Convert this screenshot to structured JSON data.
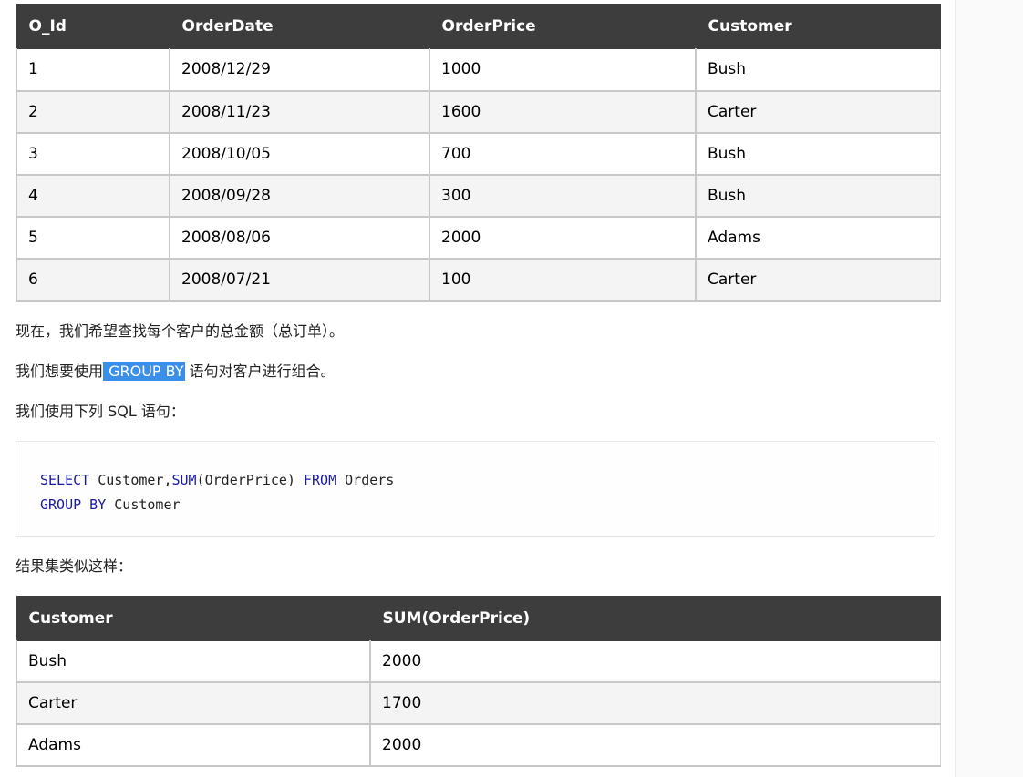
{
  "orders_table": {
    "headers": [
      "O_Id",
      "OrderDate",
      "OrderPrice",
      "Customer"
    ],
    "rows": [
      [
        "1",
        "2008/12/29",
        "1000",
        "Bush"
      ],
      [
        "2",
        "2008/11/23",
        "1600",
        "Carter"
      ],
      [
        "3",
        "2008/10/05",
        "700",
        "Bush"
      ],
      [
        "4",
        "2008/09/28",
        "300",
        "Bush"
      ],
      [
        "5",
        "2008/08/06",
        "2000",
        "Adams"
      ],
      [
        "6",
        "2008/07/21",
        "100",
        "Carter"
      ]
    ]
  },
  "para1": "现在，我们希望查找每个客户的总金额（总订单）。",
  "para2": {
    "before": "我们想要使用",
    "highlight": " GROUP BY",
    "after": " 语句对客户进行组合。"
  },
  "para3": "我们使用下列 SQL 语句：",
  "code": {
    "line1": {
      "kw1": "SELECT",
      "t1": " Customer,",
      "kw2": "SUM",
      "t2": "(OrderPrice) ",
      "kw3": "FROM",
      "t3": " Orders"
    },
    "line2": {
      "kw1": "GROUP BY",
      "t1": " Customer"
    }
  },
  "para4": "结果集类似这样：",
  "result_table": {
    "headers": [
      "Customer",
      "SUM(OrderPrice)"
    ],
    "rows": [
      [
        "Bush",
        "2000"
      ],
      [
        "Carter",
        "1700"
      ],
      [
        "Adams",
        "2000"
      ]
    ]
  }
}
